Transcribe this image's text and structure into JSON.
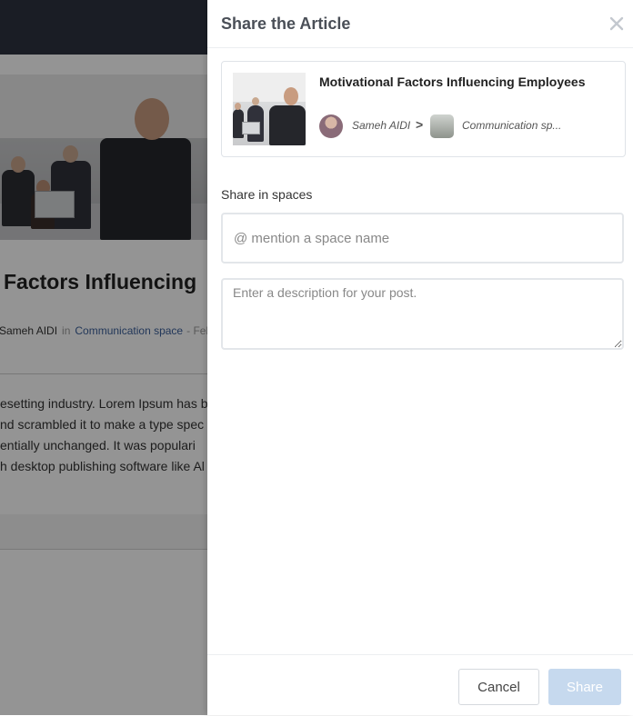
{
  "background": {
    "article_title": "Factors Influencing",
    "author": "Sameh AIDI",
    "in_label": "in",
    "space": "Communication space",
    "date_fragment": "- Feb",
    "body_lines": [
      "esetting industry. Lorem Ipsum has b",
      "nd scrambled it to make a type spec",
      "entially unchanged. It was populari",
      "h desktop publishing software like Al"
    ]
  },
  "drawer": {
    "title": "Share the Article",
    "close_icon": "close-icon",
    "article": {
      "title": "Motivational Factors Influencing Employees",
      "author": "Sameh AIDI",
      "separator": ">",
      "space": "Communication sp..."
    },
    "share_in_spaces_label": "Share in spaces",
    "mention_placeholder": "@ mention a space name",
    "description_placeholder": "Enter a description for your post.",
    "cancel_label": "Cancel",
    "share_label": "Share"
  },
  "colors": {
    "topbar": "#2e3340",
    "share_button_disabled": "#c6d9ee",
    "link": "#3b5f9a"
  }
}
